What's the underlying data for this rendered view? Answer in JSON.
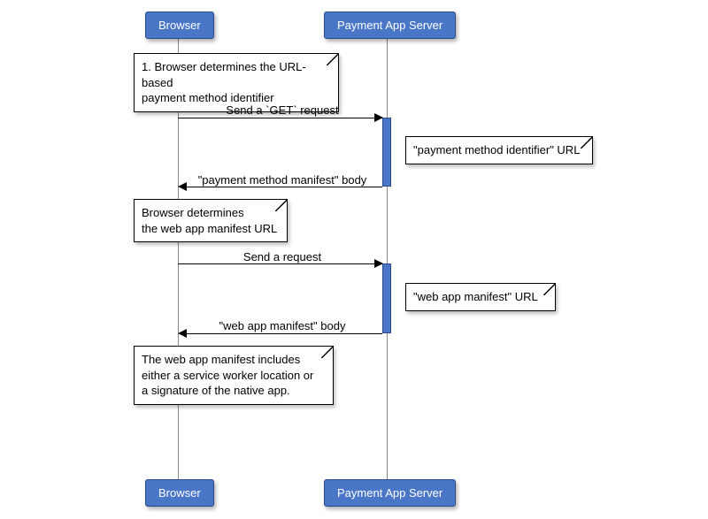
{
  "participants": {
    "left": "Browser",
    "right": "Payment App Server"
  },
  "notes": {
    "n1": "1. Browser determines the URL-based\npayment method identifier",
    "n2": "\"payment method identifier\" URL",
    "n3": "Browser determines\nthe web app manifest URL",
    "n4": "\"web app manifest\" URL",
    "n5": "The web app manifest includes\neither a service worker location or\na signature of the native app."
  },
  "messages": {
    "m1": "Send a `GET` request",
    "m2": "\"payment method manifest\" body",
    "m3": "Send a request",
    "m4": "\"web app manifest\" body"
  }
}
